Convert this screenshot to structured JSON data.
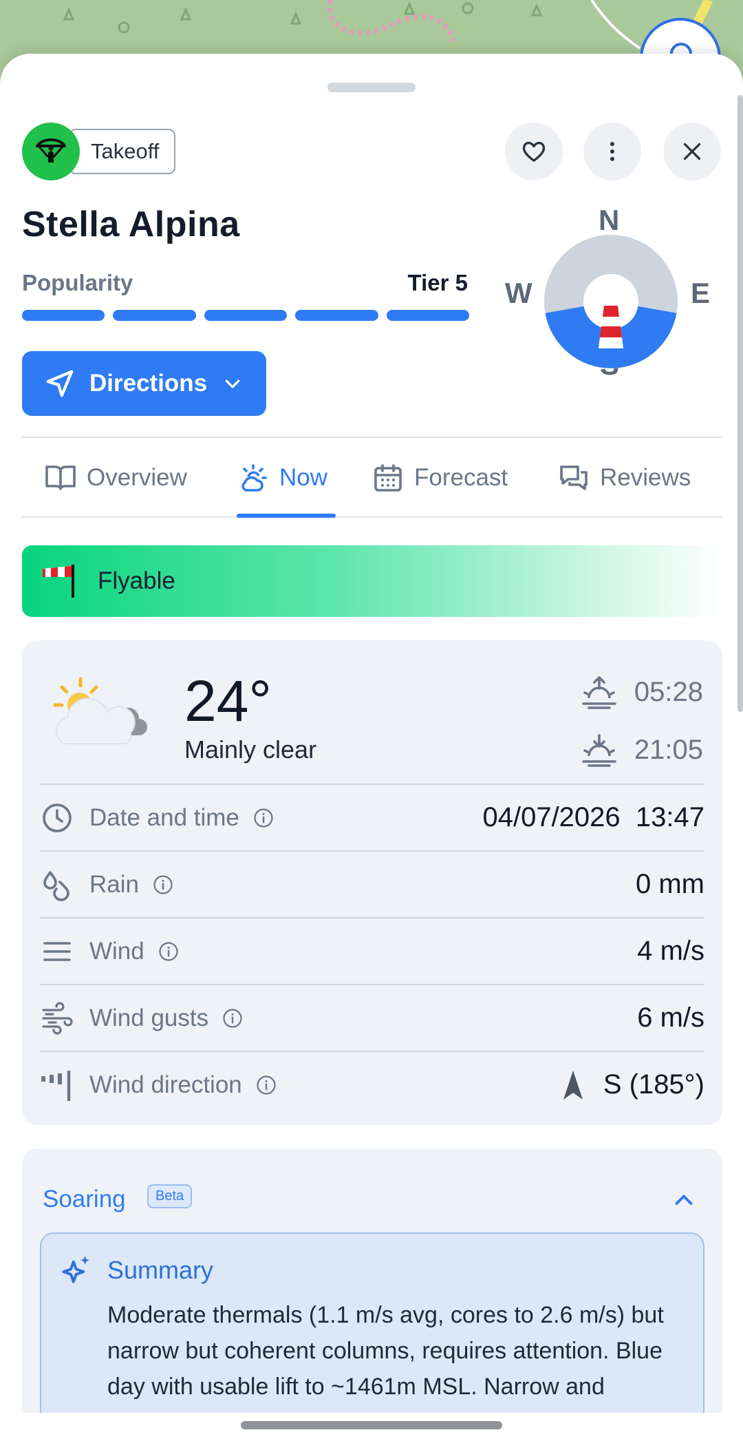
{
  "colors": {
    "accent": "#2f7bf3",
    "takeoff_green": "#20c04a",
    "flyable_green": "#08d47e",
    "card_bg": "#eff2f7",
    "windsock_red": "#e0242b"
  },
  "header": {
    "badge_label": "Takeoff",
    "badge_icon": "paraglider-icon",
    "favorite_icon": "heart-icon",
    "more_icon": "more-vertical-icon",
    "close_icon": "close-icon"
  },
  "site": {
    "title": "Stella Alpina",
    "popularity_label": "Popularity",
    "popularity_tier": "Tier 5",
    "tier_filled": 5,
    "tier_total": 5
  },
  "directions": {
    "label": "Directions",
    "icon": "navigation-arrow-icon"
  },
  "compass": {
    "n": "N",
    "e": "E",
    "s": "S",
    "w": "W",
    "favorable_from_deg": 100,
    "favorable_to_deg": 260
  },
  "tabs": [
    {
      "label": "Overview",
      "icon": "book-icon"
    },
    {
      "label": "Now",
      "icon": "sun-cloud-icon"
    },
    {
      "label": "Forecast",
      "icon": "calendar-icon"
    },
    {
      "label": "Reviews",
      "icon": "chat-icon"
    }
  ],
  "status": {
    "label": "Flyable",
    "icon": "windsock-icon"
  },
  "weather": {
    "temperature": "24°",
    "condition": "Mainly clear",
    "sunrise": "05:28",
    "sunset": "21:05",
    "rows": [
      {
        "label": "Date and time",
        "value": "04/07/2026  13:47",
        "icon": "clock-icon"
      },
      {
        "label": "Rain",
        "value": "0 mm",
        "icon": "droplets-icon"
      },
      {
        "label": "Wind",
        "value": "4 m/s",
        "icon": "wind-lines-icon"
      },
      {
        "label": "Wind gusts",
        "value": "6 m/s",
        "icon": "wind-gusts-icon"
      },
      {
        "label": "Wind direction",
        "value": "S (185°)",
        "icon": "wind-direction-icon"
      }
    ]
  },
  "soaring": {
    "title": "Soaring",
    "badge": "Beta",
    "summary_title": "Summary",
    "summary_text": "Moderate thermals (1.1 m/s avg, cores to 2.6 m/s) but narrow but coherent columns, requires attention. Blue day with usable lift to ~1461m MSL. Narrow and coherent, moderate lift, use light"
  }
}
